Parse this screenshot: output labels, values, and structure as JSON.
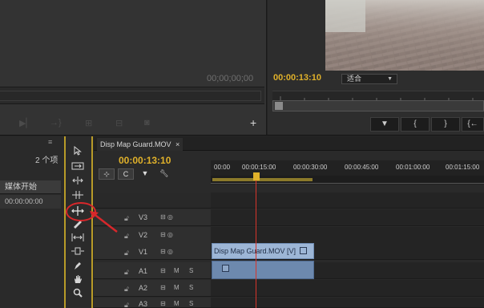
{
  "source_monitor": {
    "timecode": "00;00;00;00"
  },
  "program_monitor": {
    "timecode": "00:00:13:10",
    "fit_label": "适合",
    "buttons": [
      "▼",
      "{",
      "}",
      "{←"
    ]
  },
  "project_panel": {
    "item_count": "2 个项",
    "column_header": "媒体开始",
    "row_value": "00:00:00:00",
    "menu_icon": "≡"
  },
  "timeline": {
    "tab_label": "Disp Map Guard.MOV",
    "tab_close": "×",
    "timecode": "00:00:13:10",
    "ruler_ticks": [
      "00:00",
      "00:00:15:00",
      "00:00:30:00",
      "00:00:45:00",
      "00:01:00:00",
      "00:01:15:00"
    ],
    "tracks": [
      {
        "name": "V3",
        "lock": "🔒",
        "mute": ""
      },
      {
        "name": "V2",
        "lock": "🔒",
        "mute": ""
      },
      {
        "name": "V1",
        "lock": "🔒",
        "mute": ""
      },
      {
        "name": "A1",
        "lock": "🔒",
        "mute": "M",
        "solo": "S"
      },
      {
        "name": "A2",
        "lock": "🔒",
        "mute": "M",
        "solo": "S"
      },
      {
        "name": "A3",
        "lock": "🔒",
        "mute": "M",
        "solo": "S"
      }
    ],
    "video_clip_label": "Disp Map Guard.MOV [V]",
    "audio_clip_label": "fx"
  },
  "colors": {
    "accent_timecode": "#e0b12a",
    "playhead": "#d7352b",
    "annotation": "#d8272b",
    "video_clip": "#9db6d6",
    "audio_clip": "#6d89ae"
  }
}
